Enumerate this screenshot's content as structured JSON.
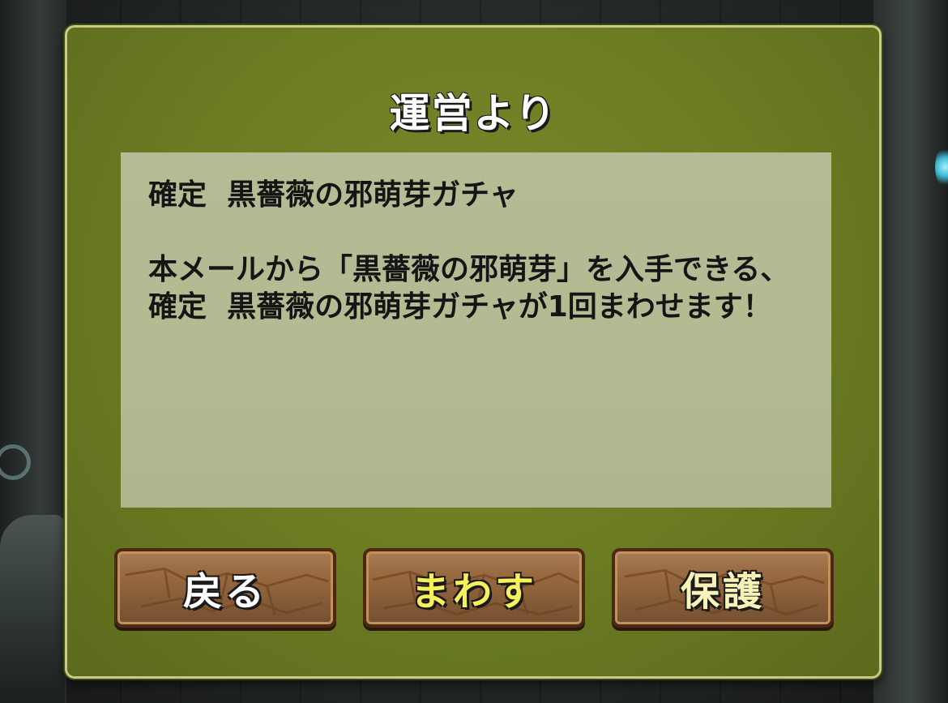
{
  "dialog": {
    "title": "運営より",
    "message": {
      "subject": "確定  黒薔薇の邪萌芽ガチャ",
      "body": "本メールから「黒薔薇の邪萌芽」を入手できる、確定  黒薔薇の邪萌芽ガチャが1回まわせます！"
    },
    "buttons": {
      "back": "戻る",
      "spin": "まわす",
      "protect": "保護"
    }
  },
  "colors": {
    "dialog_bg": "#6a7b22",
    "panel_bg": "#b6bb95",
    "button_bg": "#9a6a40",
    "spin_label": "#f6f05a"
  }
}
